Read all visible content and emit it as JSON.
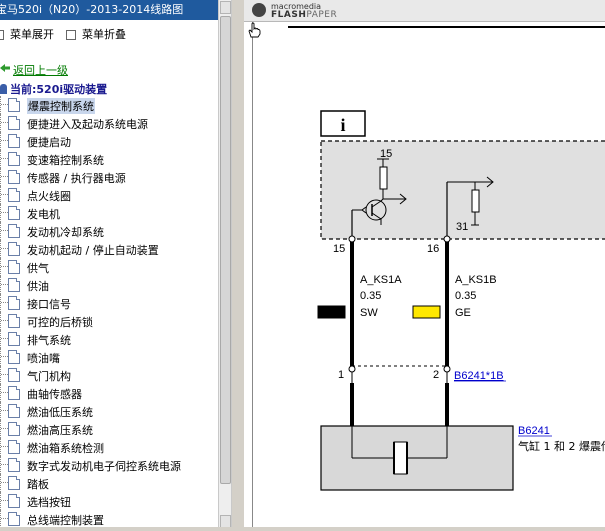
{
  "window": {
    "title": "宝马520i（N20）-2013-2014线路图"
  },
  "menu": {
    "expand_label": "菜单展开",
    "collapse_label": "菜单折叠"
  },
  "nav": {
    "back_label": "返回上一级",
    "current_label": "当前:520i驱动装置"
  },
  "tree": [
    "爆震控制系统",
    "便捷进入及起动系统电源",
    "便捷启动",
    "变速箱控制系统",
    "传感器 / 执行器电源",
    "点火线圈",
    "发电机",
    "发动机冷却系统",
    "发动机起动 / 停止自动装置",
    "供气",
    "供油",
    "接口信号",
    "可控的后桥锁",
    "排气系统",
    "喷油嘴",
    "气门机构",
    "曲轴传感器",
    "燃油低压系统",
    "燃油高压系统",
    "燃油箱系统检测",
    "数字式发动机电子伺控系统电源",
    "踏板",
    "选档按钮",
    "总线端控制装置"
  ],
  "viewer": {
    "brand_small": "macromedia",
    "brand_main": "FLASH",
    "brand_sub": "PAPER"
  },
  "diagram": {
    "info_symbol": "i",
    "pin_15_top": "15",
    "pin_31": "31",
    "left_pin": "15",
    "right_pin": "16",
    "left_wire": {
      "name": "A_KS1A",
      "size": "0.35",
      "color_code": "SW",
      "swatch": "#000000"
    },
    "right_wire": {
      "name": "A_KS1B",
      "size": "0.35",
      "color_code": "GE",
      "swatch": "#ffe800"
    },
    "conn_left_pin": "1",
    "conn_right_pin": "2",
    "connector_link": "B6241*1B",
    "component_link": "B6241",
    "component_desc": "气缸 1 和 2 爆震传"
  },
  "colors": {
    "titlebar": "#1f5a9e",
    "module_fill": "#e0e0e0",
    "link": "#0000cc",
    "selected": "#c8d6ec"
  }
}
